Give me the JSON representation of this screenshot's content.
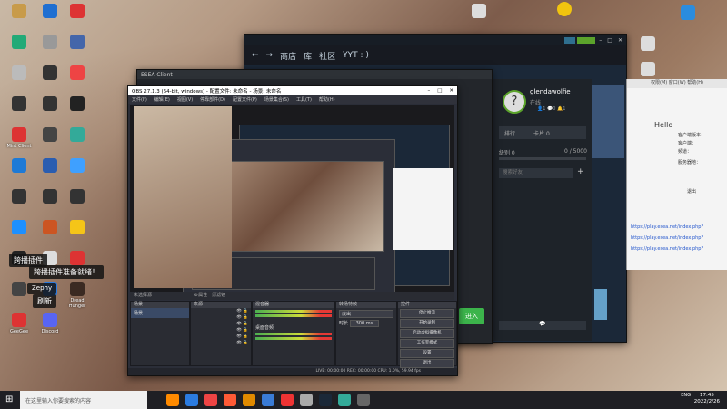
{
  "desktop": {
    "icons_left": [
      {
        "label": "",
        "color": "#c89b4a"
      },
      {
        "label": "",
        "color": "#1f6fd1"
      },
      {
        "label": "",
        "color": "#d33"
      },
      {
        "label": "",
        "color": "#2a7"
      },
      {
        "label": "",
        "color": "#999"
      },
      {
        "label": "",
        "color": "#46a"
      },
      {
        "label": "",
        "color": "#bbb"
      },
      {
        "label": "",
        "color": "#333"
      },
      {
        "label": "",
        "color": "#e44"
      },
      {
        "label": "",
        "color": "#333"
      },
      {
        "label": "",
        "color": "#333"
      },
      {
        "label": "",
        "color": "#222"
      },
      {
        "label": "Mint Client",
        "color": "#d33"
      },
      {
        "label": "",
        "color": "#444"
      },
      {
        "label": "",
        "color": "#3a9"
      },
      {
        "label": "",
        "color": "#1e7ad6"
      },
      {
        "label": "",
        "color": "#2a5db0"
      },
      {
        "label": "",
        "color": "#3fa0ff"
      },
      {
        "label": "",
        "color": "#333"
      },
      {
        "label": "",
        "color": "#333"
      },
      {
        "label": "",
        "color": "#333"
      },
      {
        "label": "",
        "color": "#1e90ff"
      },
      {
        "label": "",
        "color": "#c52"
      },
      {
        "label": "",
        "color": "#f5c518"
      },
      {
        "label": "",
        "color": "#222"
      },
      {
        "label": "",
        "color": "#ddd"
      },
      {
        "label": "",
        "color": "#d33"
      },
      {
        "label": "",
        "color": "#444"
      },
      {
        "label": "",
        "color": "#2a7be0"
      },
      {
        "label": "Dread Hunger",
        "color": "#3a2a22"
      },
      {
        "label": "GeeGee",
        "color": "#d33"
      },
      {
        "label": "Discord",
        "color": "#5865f2"
      }
    ],
    "icons_top": [
      {
        "label": "",
        "color": "#ddd"
      },
      {
        "label": "",
        "color": "#f1c40f"
      },
      {
        "label": "",
        "color": "#2b8cde"
      }
    ],
    "icons_right": [
      {
        "label": "",
        "color": "#ddd"
      },
      {
        "label": "",
        "color": "#ddd"
      }
    ],
    "toast_plugin": "跨播插件",
    "toast_ready": "跨播插件准备就绪！",
    "toast_zephy": "Zephy",
    "toast_refresh": "刷新"
  },
  "steam": {
    "nav": [
      "商店",
      "库",
      "社区"
    ],
    "username": "YYT : )",
    "friend_name": "glendawolfie",
    "friend_status": "在线",
    "friend_labels": [
      "排行",
      "卡片"
    ],
    "friend_counts": [
      0,
      0
    ],
    "stats_left": "级别 0",
    "stats_right": "0 / 5000",
    "search_placeholder": "搜索好友"
  },
  "esea": {
    "title": "ESEA Client",
    "play_label": "进入"
  },
  "obs": {
    "title": "OBS 27.1.3 (64-bit, windows) - 配置文件: 未命名 - 场景: 未命名",
    "menu": [
      "文件(F)",
      "编辑(E)",
      "视图(V)",
      "停靠部件(D)",
      "配置文件(P)",
      "场景集合(S)",
      "工具(T)",
      "帮助(H)"
    ],
    "docks": [
      {
        "title": "场景",
        "items": [
          "场景"
        ]
      },
      {
        "title": "来源",
        "items": [
          "",
          "",
          "",
          "",
          "",
          ""
        ]
      },
      {
        "title": "混音器",
        "items": [
          "",
          "桌面音频"
        ]
      },
      {
        "title": "转场特效",
        "items": [
          "淡出",
          "时长",
          "300 ms"
        ]
      },
      {
        "title": "控件",
        "items": [
          "停止推流",
          "开始录制",
          "启动虚拟摄像机",
          "工作室模式",
          "设置",
          "退出"
        ]
      }
    ],
    "status": "LIVE: 00:00:00   REC: 00:00:00   CPU: 1.0%, 59.94 fps"
  },
  "browser": {
    "url1": "https://play.esea.net/index.php?",
    "url2": "https://play.esea.net/index.php?",
    "url3": "https://play.esea.net/index.php?",
    "lines": [
      "客户端版本：",
      "客户端：",
      "频道：",
      "服务器地：",
      "退出"
    ]
  },
  "taskbar": {
    "search_placeholder": "在这里输入你要搜索的内容",
    "time": "17:45",
    "date": "2022/2/26",
    "lang": "ENG"
  }
}
